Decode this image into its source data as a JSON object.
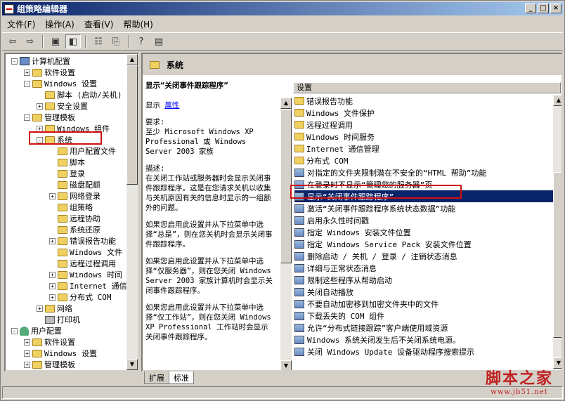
{
  "window": {
    "title": "组策略编辑器",
    "buttons": [
      "_",
      "□",
      "×"
    ]
  },
  "menu": [
    {
      "label": "文件(F)"
    },
    {
      "label": "操作(A)"
    },
    {
      "label": "查看(V)"
    },
    {
      "label": "帮助(H)"
    }
  ],
  "toolbar": {
    "icons": [
      "back-icon",
      "forward-icon",
      "up-folder-icon",
      "show-hide-tree-icon",
      "properties-icon",
      "export-list-icon",
      "help-icon",
      "console-icon"
    ]
  },
  "tree": [
    {
      "label": "计算机配置",
      "level": 0,
      "expander": "-",
      "icon": "pc"
    },
    {
      "label": "软件设置",
      "level": 1,
      "expander": "+",
      "icon": "folder"
    },
    {
      "label": "Windows 设置",
      "level": 1,
      "expander": "-",
      "icon": "folder"
    },
    {
      "label": "脚本 (启动/关机)",
      "level": 2,
      "expander": "",
      "icon": "folder"
    },
    {
      "label": "安全设置",
      "level": 2,
      "expander": "+",
      "icon": "folder"
    },
    {
      "label": "管理模板",
      "level": 1,
      "expander": "-",
      "icon": "folder"
    },
    {
      "label": "Windows 组件",
      "level": 2,
      "expander": "+",
      "icon": "folder"
    },
    {
      "label": "系统",
      "level": 2,
      "expander": "-",
      "icon": "folder"
    },
    {
      "label": "用户配置文件",
      "level": 3,
      "expander": "",
      "icon": "folder"
    },
    {
      "label": "脚本",
      "level": 3,
      "expander": "",
      "icon": "folder"
    },
    {
      "label": "登录",
      "level": 3,
      "expander": "",
      "icon": "folder"
    },
    {
      "label": "磁盘配额",
      "level": 3,
      "expander": "",
      "icon": "folder"
    },
    {
      "label": "网络登录",
      "level": 3,
      "expander": "+",
      "icon": "folder"
    },
    {
      "label": "组策略",
      "level": 3,
      "expander": "",
      "icon": "folder"
    },
    {
      "label": "远程协助",
      "level": 3,
      "expander": "",
      "icon": "folder"
    },
    {
      "label": "系统还原",
      "level": 3,
      "expander": "",
      "icon": "folder"
    },
    {
      "label": "错误报告功能",
      "level": 3,
      "expander": "+",
      "icon": "folder"
    },
    {
      "label": "Windows 文件",
      "level": 3,
      "expander": "",
      "icon": "folder"
    },
    {
      "label": "远程过程调用",
      "level": 3,
      "expander": "",
      "icon": "folder"
    },
    {
      "label": "Windows 时间",
      "level": 3,
      "expander": "+",
      "icon": "folder"
    },
    {
      "label": "Internet 通信",
      "level": 3,
      "expander": "+",
      "icon": "folder"
    },
    {
      "label": "分布式 COM",
      "level": 3,
      "expander": "+",
      "icon": "folder"
    },
    {
      "label": "网络",
      "level": 2,
      "expander": "+",
      "icon": "folder"
    },
    {
      "label": "打印机",
      "level": 2,
      "expander": "",
      "icon": "printer"
    },
    {
      "label": "用户配置",
      "level": 0,
      "expander": "-",
      "icon": "user"
    },
    {
      "label": "软件设置",
      "level": 1,
      "expander": "+",
      "icon": "folder"
    },
    {
      "label": "Windows 设置",
      "level": 1,
      "expander": "+",
      "icon": "folder"
    },
    {
      "label": "管理模板",
      "level": 1,
      "expander": "+",
      "icon": "folder"
    }
  ],
  "right_header": "系统",
  "description": {
    "title": "显示“关闭事件跟踪程序”",
    "show_label": "显示",
    "properties_link": "属性",
    "requirements_label": "要求:",
    "requirements_text": "至少 Microsoft Windows XP Professional 或 Windows Server 2003 家族",
    "desc_label": "描述:",
    "desc_text": "在关闭工作站或服务器时会显示关闭事件跟踪程序。这是在您请求关机以收集与关机原因有关的信息时显示的一组额外的问题。",
    "p1": "如果您启用此设置并从下拉菜单中选择“总是”，则在您关机时会显示关闭事件跟踪程序。",
    "p2": "如果您启用此设置并从下拉菜单中选择“仅服务器”，则在您关闭 Windows Server 2003 家族计算机时会显示关闭事件跟踪程序。",
    "p3": "如果您启用此设置并从下拉菜单中选择“仅工作站”，则在您关闭 Windows XP Professional 工作站时会显示关闭事件跟踪程序。"
  },
  "list_header": "设置",
  "list": [
    {
      "label": "错误报告功能",
      "icon": "folder"
    },
    {
      "label": "Windows 文件保护",
      "icon": "folder"
    },
    {
      "label": "远程过程调用",
      "icon": "folder"
    },
    {
      "label": "Windows 时间服务",
      "icon": "folder"
    },
    {
      "label": "Internet 通信管理",
      "icon": "folder"
    },
    {
      "label": "分布式 COM",
      "icon": "folder"
    },
    {
      "label": "对指定的文件夹限制潜在不安全的“HTML 帮助”功能",
      "icon": "setting"
    },
    {
      "label": "在登录时不显示“管理您的服务器”页",
      "icon": "setting"
    },
    {
      "label": "显示“关闭事件跟踪程序”",
      "icon": "setting",
      "selected": true
    },
    {
      "label": "激活“关闭事件跟踪程序系统状态数据”功能",
      "icon": "setting"
    },
    {
      "label": "启用永久性时间戳",
      "icon": "setting"
    },
    {
      "label": "指定 Windows 安装文件位置",
      "icon": "setting"
    },
    {
      "label": "指定 Windows Service Pack 安装文件位置",
      "icon": "setting"
    },
    {
      "label": "删除启动 / 关机 / 登录 / 注销状态消息",
      "icon": "setting"
    },
    {
      "label": "详细与正常状态消息",
      "icon": "setting"
    },
    {
      "label": "限制这些程序从帮助启动",
      "icon": "setting"
    },
    {
      "label": "关闭自动播放",
      "icon": "setting"
    },
    {
      "label": "不要自动加密移到加密文件夹中的文件",
      "icon": "setting"
    },
    {
      "label": "下载丢失的 COM 组件",
      "icon": "setting"
    },
    {
      "label": "允许“分布式链接跟踪”客户端使用域资源",
      "icon": "setting"
    },
    {
      "label": "Windows 系统关闭发生后不关闭系统电源。",
      "icon": "setting"
    },
    {
      "label": "关闭 Windows Update 设备驱动程序搜索提示",
      "icon": "setting"
    }
  ],
  "tabs": [
    {
      "label": "扩展"
    },
    {
      "label": "标准"
    }
  ],
  "watermark": {
    "brand": "脚本之家",
    "url": "www.jb51.net"
  },
  "annotation_color": "#d01010"
}
